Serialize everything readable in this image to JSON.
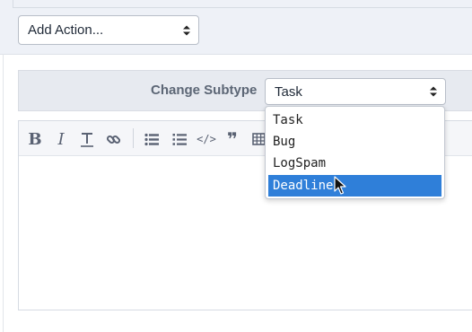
{
  "add_action": {
    "value": "Add Action..."
  },
  "subtype": {
    "label": "Change Subtype",
    "selected_value": "Task",
    "options": [
      "Task",
      "Bug",
      "LogSpam",
      "Deadline"
    ],
    "highlighted_index": 3
  },
  "toolbar": {
    "buttons": [
      {
        "name": "bold-icon",
        "glyph": "B"
      },
      {
        "name": "italic-icon",
        "glyph": "I"
      },
      {
        "name": "monospace-icon",
        "glyph": "T"
      },
      {
        "name": "link-icon",
        "glyph": ""
      },
      {
        "name": "bulleted-list-icon",
        "glyph": ""
      },
      {
        "name": "numbered-list-icon",
        "glyph": ""
      },
      {
        "name": "code-icon",
        "glyph": "</>"
      },
      {
        "name": "quote-icon",
        "glyph": "❞"
      },
      {
        "name": "table-icon",
        "glyph": ""
      }
    ]
  },
  "colors": {
    "highlight": "#2f7fd9",
    "label": "#5c6675",
    "toolbar_icon": "#5a6273"
  }
}
